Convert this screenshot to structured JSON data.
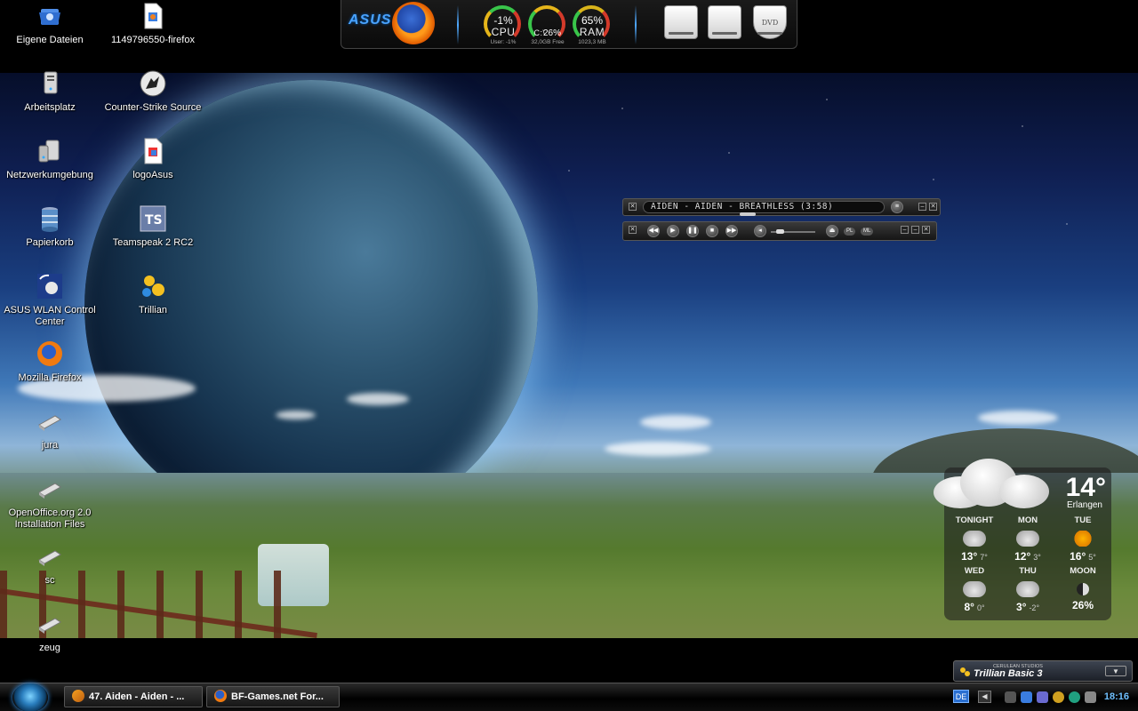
{
  "desktop_icons": [
    {
      "label": "Eigene Dateien"
    },
    {
      "label": "1149796550-firefox"
    },
    {
      "label": "Arbeitsplatz"
    },
    {
      "label": "Counter-Strike Source"
    },
    {
      "label": "Netzwerkumgebung"
    },
    {
      "label": "logoAsus"
    },
    {
      "label": "Papierkorb"
    },
    {
      "label": "Teamspeak 2 RC2"
    },
    {
      "label": "ASUS WLAN Control Center"
    },
    {
      "label": "Trillian"
    },
    {
      "label": "Mozilla Firefox"
    },
    {
      "label": "jura"
    },
    {
      "label": "OpenOffice.org 2.0 Installation Files"
    },
    {
      "label": "sc"
    },
    {
      "label": "zeug"
    }
  ],
  "sysmon": {
    "brand": "ASUS",
    "cpu": {
      "pct": "-1%",
      "label": "CPU",
      "sub": "User: -1%"
    },
    "disk": {
      "pct": "26%",
      "label": "C:\\",
      "sub": "32,0GB Free"
    },
    "ram": {
      "pct": "65%",
      "label": "RAM",
      "sub": "1023,3 MB"
    },
    "dvd_label": "DVD"
  },
  "player": {
    "track": "AIDEN - AIDEN - BREATHLESS (3:58)",
    "playlist_label": "PL",
    "library_label": "ML"
  },
  "weather": {
    "temp": "14°",
    "city": "Erlangen",
    "days": [
      {
        "name": "TONIGHT",
        "hi": "13°",
        "lo": "7°",
        "icon": "rain-icon"
      },
      {
        "name": "MON",
        "hi": "12°",
        "lo": "3°",
        "icon": "rain-icon"
      },
      {
        "name": "TUE",
        "hi": "16°",
        "lo": "5°",
        "icon": "sun-icon"
      },
      {
        "name": "WED",
        "hi": "8°",
        "lo": "0°",
        "icon": "rain-icon"
      },
      {
        "name": "THU",
        "hi": "3°",
        "lo": "-2°",
        "icon": "snow-icon"
      },
      {
        "name": "MOON",
        "hi": "26%",
        "lo": "",
        "icon": "moon-icon"
      }
    ]
  },
  "trillian": {
    "subtitle": "CERULEAN STUDIOS",
    "name": "Trillian Basic 3"
  },
  "taskbar": {
    "tasks": [
      {
        "label": "47. Aiden - Aiden - ..."
      },
      {
        "label": "BF-Games.net For..."
      }
    ],
    "language": "DE",
    "clock": "18:16"
  }
}
